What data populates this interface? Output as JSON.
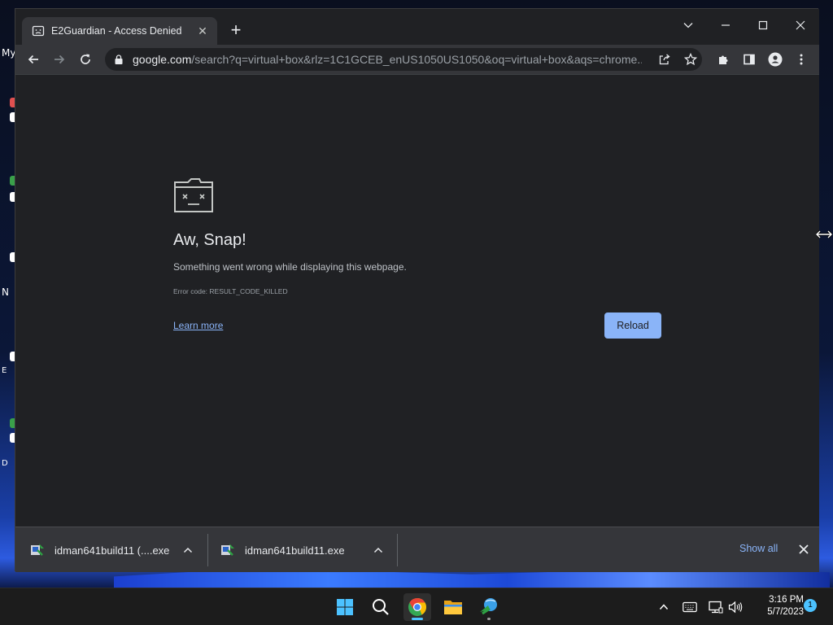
{
  "desktop": {
    "icon_labels": [
      "My",
      "N",
      "E",
      "D"
    ]
  },
  "browser": {
    "tab": {
      "title": "E2Guardian - Access Denied",
      "favicon": "sad-page-icon",
      "close_glyph": "✕"
    },
    "new_tab_glyph": "+",
    "window_controls": [
      "chevron-down-icon",
      "minimize-icon",
      "maximize-icon",
      "close-icon"
    ],
    "toolbar": {
      "back": "arrow-left-icon",
      "forward": "arrow-right-icon",
      "reload": "reload-icon",
      "url_host": "google.com",
      "url_path": "/search?q=virtual+box&rlz=1C1GCEB_enUS1050US1050&oq=virtual+box&aqs=chrome.....",
      "omnibox_actions": [
        "share-icon",
        "star-icon"
      ],
      "extras": [
        "extensions-icon",
        "side-panel-icon",
        "profile-icon",
        "menu-icon"
      ]
    },
    "error_page": {
      "title": "Aw, Snap!",
      "message": "Something went wrong while displaying this webpage.",
      "error_code": "Error code: RESULT_CODE_KILLED",
      "learn_more": "Learn more",
      "reload_label": "Reload"
    },
    "downloads": {
      "items": [
        {
          "filename": "idman641build11 (....exe"
        },
        {
          "filename": "idman641build11.exe"
        }
      ],
      "show_all": "Show all"
    }
  },
  "taskbar": {
    "apps": [
      "windows-start-icon",
      "search-icon",
      "chrome-icon",
      "file-explorer-icon",
      "internet-download-manager-icon"
    ],
    "tray": [
      "chevron-up-icon",
      "keyboard-icon",
      "network-icon",
      "volume-icon"
    ],
    "time": "3:16 PM",
    "date": "5/7/2023",
    "notification_count": "1"
  },
  "colors": {
    "accent": "#8ab4f8",
    "window_bg": "#202124",
    "toolbar_bg": "#35363a",
    "taskbar_bg": "#1c1c1c",
    "taskbar_indicator": "#4cc2ff"
  }
}
